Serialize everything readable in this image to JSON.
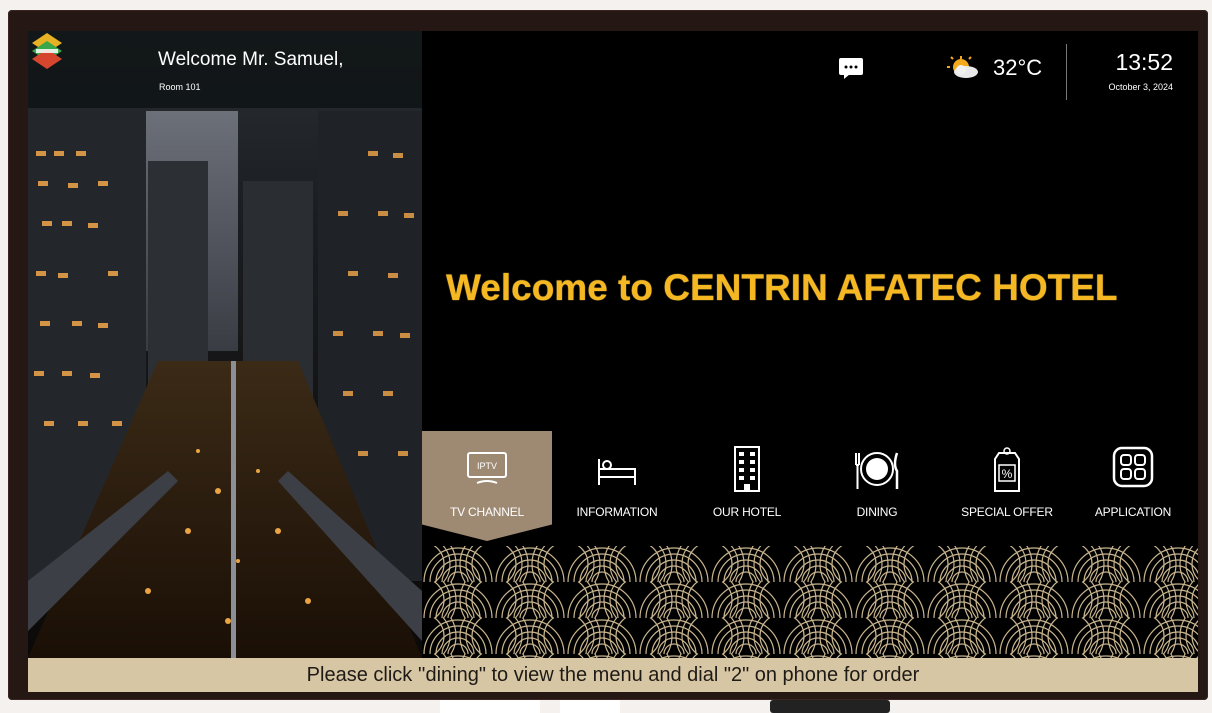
{
  "header": {
    "welcome": "Welcome Mr. Samuel,",
    "room": "Room 101",
    "temperature": "32°C",
    "time": "13:52",
    "date": "October 3, 2024"
  },
  "hero": {
    "title": "Welcome to CENTRIN AFATEC HOTEL"
  },
  "menu": [
    {
      "label": "TV CHANNEL",
      "badge": "IPTV",
      "icon": "tv-icon",
      "active": true
    },
    {
      "label": "INFORMATION",
      "icon": "bed-icon",
      "active": false
    },
    {
      "label": "OUR HOTEL",
      "icon": "building-icon",
      "active": false
    },
    {
      "label": "DINING",
      "icon": "plate-cutlery-icon",
      "active": false
    },
    {
      "label": "SPECIAL OFFER",
      "icon": "discount-tag-icon",
      "active": false
    },
    {
      "label": "APPLICATION",
      "icon": "apps-grid-icon",
      "active": false
    }
  ],
  "ticker": {
    "text": "Please click ''dining\" to view the menu and dial \"2\" on phone for order"
  },
  "colors": {
    "accent_gold": "#f5b822",
    "active_tile": "#9e8a73",
    "ticker_bg": "#d7c6a4",
    "pattern_line": "#c8b58e"
  }
}
